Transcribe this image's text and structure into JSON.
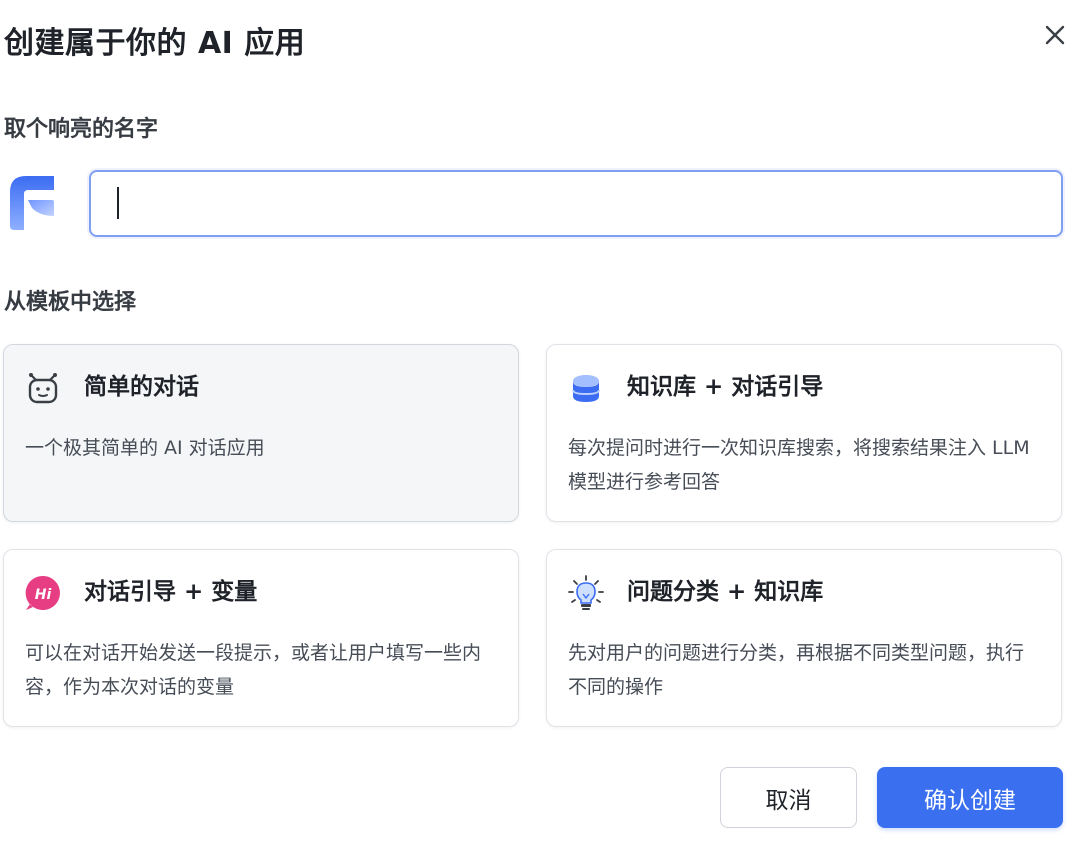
{
  "dialog": {
    "title": "创建属于你的 AI 应用"
  },
  "name_section": {
    "label": "取个响亮的名字",
    "input_value": ""
  },
  "template_section": {
    "label": "从模板中选择",
    "cards": [
      {
        "title": "简单的对话",
        "description": "一个极其简单的 AI 对话应用",
        "icon": "robot-icon",
        "selected": true
      },
      {
        "title": "知识库 + 对话引导",
        "description": "每次提问时进行一次知识库搜索，将搜索结果注入 LLM 模型进行参考回答",
        "icon": "database-icon",
        "selected": false
      },
      {
        "title": "对话引导 + 变量",
        "description": "可以在对话开始发送一段提示，或者让用户填写一些内容，作为本次对话的变量",
        "icon": "hi-badge-icon",
        "selected": false
      },
      {
        "title": "问题分类 + 知识库",
        "description": "先对用户的问题进行分类，再根据不同类型问题，执行不同的操作",
        "icon": "lightbulb-icon",
        "selected": false
      }
    ]
  },
  "buttons": {
    "cancel": "取消",
    "confirm": "确认创建"
  },
  "colors": {
    "accent": "#3a6ff0",
    "input_border": "#7f9ff0",
    "hi_badge": "#e63d83"
  }
}
